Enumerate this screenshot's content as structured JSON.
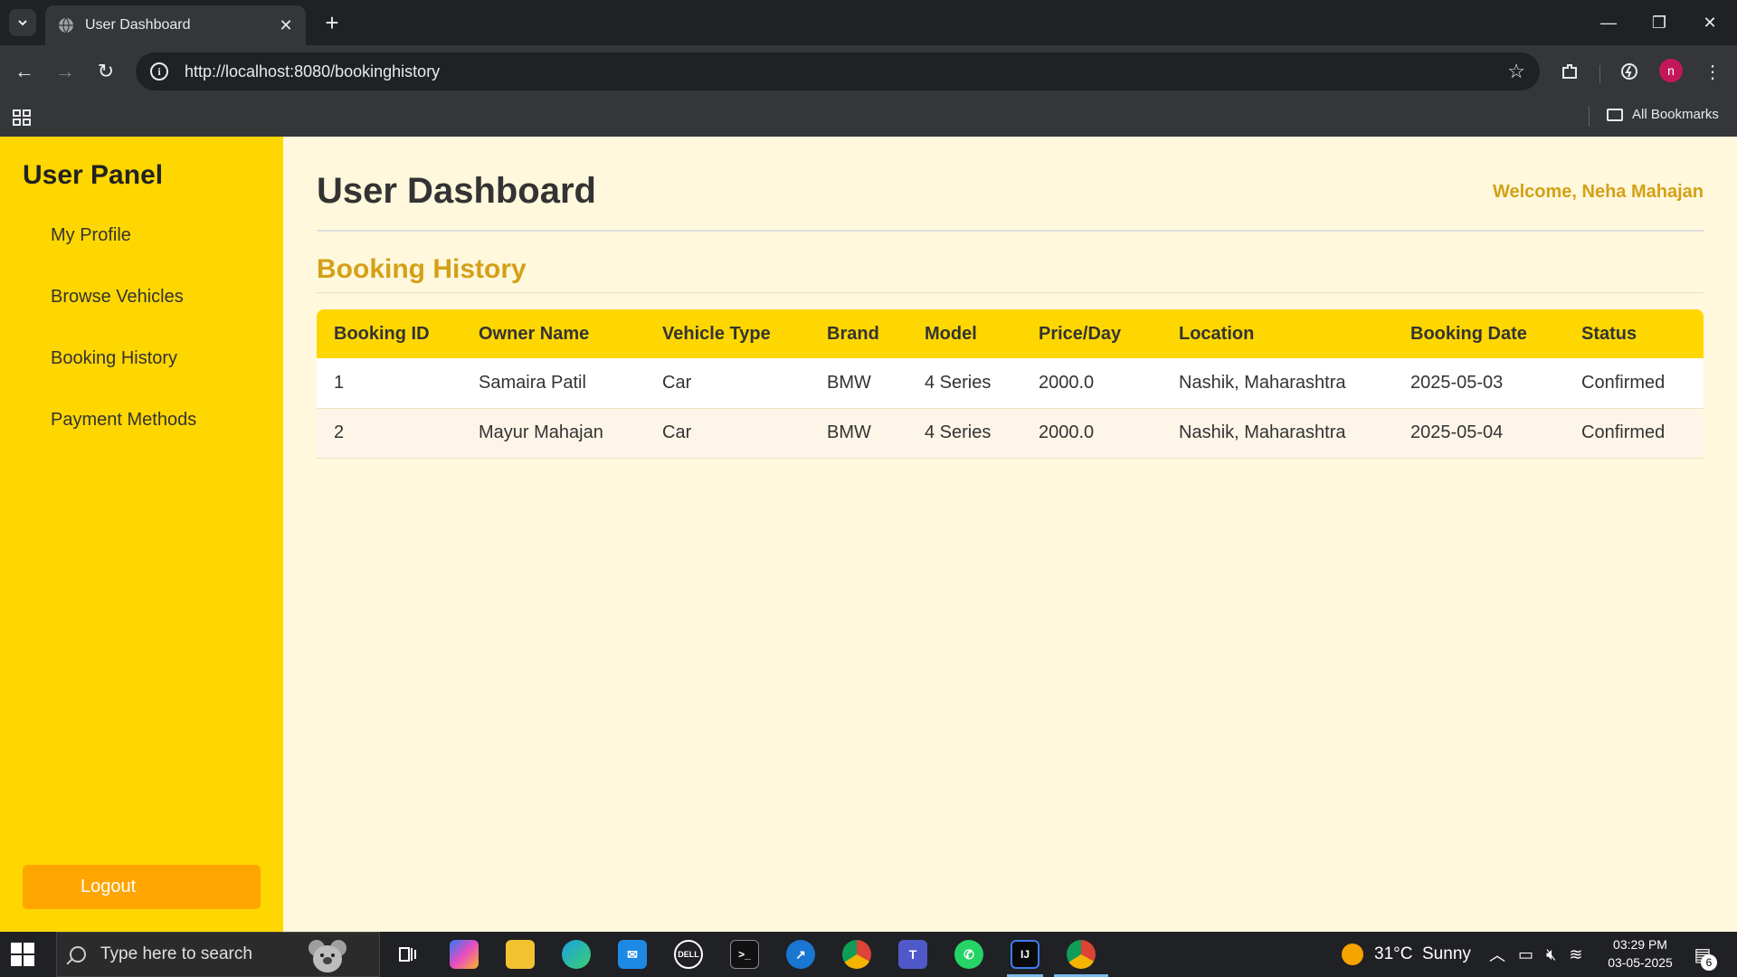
{
  "browser": {
    "tab_title": "User Dashboard",
    "url": "http://localhost:8080/bookinghistory",
    "bookmarks_label": "All Bookmarks",
    "profile_initial": "n"
  },
  "sidebar": {
    "title": "User Panel",
    "items": [
      {
        "label": "My Profile"
      },
      {
        "label": "Browse Vehicles"
      },
      {
        "label": "Booking History"
      },
      {
        "label": "Payment Methods"
      }
    ],
    "logout_label": "Logout"
  },
  "main": {
    "page_title": "User Dashboard",
    "welcome": "Welcome, Neha Mahajan",
    "section_title": "Booking History",
    "table": {
      "headers": [
        "Booking ID",
        "Owner Name",
        "Vehicle Type",
        "Brand",
        "Model",
        "Price/Day",
        "Location",
        "Booking Date",
        "Status"
      ],
      "rows": [
        [
          "1",
          "Samaira Patil",
          "Car",
          "BMW",
          "4 Series",
          "2000.0",
          "Nashik, Maharashtra",
          "2025-05-03",
          "Confirmed"
        ],
        [
          "2",
          "Mayur Mahajan",
          "Car",
          "BMW",
          "4 Series",
          "2000.0",
          "Nashik, Maharashtra",
          "2025-05-04",
          "Confirmed"
        ]
      ]
    }
  },
  "taskbar": {
    "search_placeholder": "Type here to search",
    "weather": "31°C  Sunny",
    "time": "03:29 PM",
    "date": "03-05-2025",
    "notification_count": "6"
  },
  "colors": {
    "sidebar_bg": "#ffd700",
    "page_bg": "#fff8dc",
    "accent_text": "#d4a017",
    "logout_bg": "#ffa500"
  }
}
